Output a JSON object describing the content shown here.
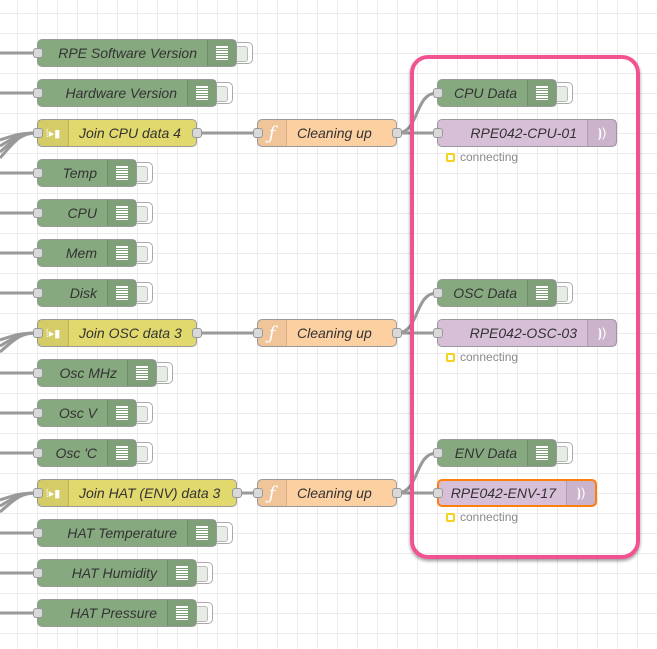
{
  "flow": {
    "debug_nodes": [
      {
        "label": "RPE Software Version"
      },
      {
        "label": "Hardware Version"
      },
      {
        "label": "Temp"
      },
      {
        "label": "CPU"
      },
      {
        "label": "Mem"
      },
      {
        "label": "Disk"
      },
      {
        "label": "Osc MHz"
      },
      {
        "label": "Osc V"
      },
      {
        "label": "Osc 'C"
      },
      {
        "label": "HAT Temperature"
      },
      {
        "label": "HAT Humidity"
      },
      {
        "label": "HAT Pressure"
      },
      {
        "label": "CPU Data"
      },
      {
        "label": "OSC Data"
      },
      {
        "label": "ENV Data"
      }
    ],
    "join_nodes": [
      {
        "label": "Join CPU data 4"
      },
      {
        "label": "Join OSC data 3"
      },
      {
        "label": "Join HAT (ENV) data 3"
      }
    ],
    "function_nodes": [
      {
        "label": "Cleaning up",
        "icon": "ƒ"
      },
      {
        "label": "Cleaning up",
        "icon": "ƒ"
      },
      {
        "label": "Cleaning up",
        "icon": "ƒ"
      }
    ],
    "mqtt_nodes": [
      {
        "label": "RPE042-CPU-01",
        "status": "connecting",
        "selected": false
      },
      {
        "label": "RPE042-OSC-03",
        "status": "connecting",
        "selected": false
      },
      {
        "label": "RPE042-ENV-17",
        "status": "connecting",
        "selected": true
      }
    ],
    "colors": {
      "debug": "#87a980",
      "join": "#e2d96e",
      "function": "#fdd0a2",
      "mqtt": "#d8bfd8",
      "group_border": "#f25390",
      "selected_border": "#ff7f0e",
      "status_connecting": "#f5d31a"
    }
  }
}
